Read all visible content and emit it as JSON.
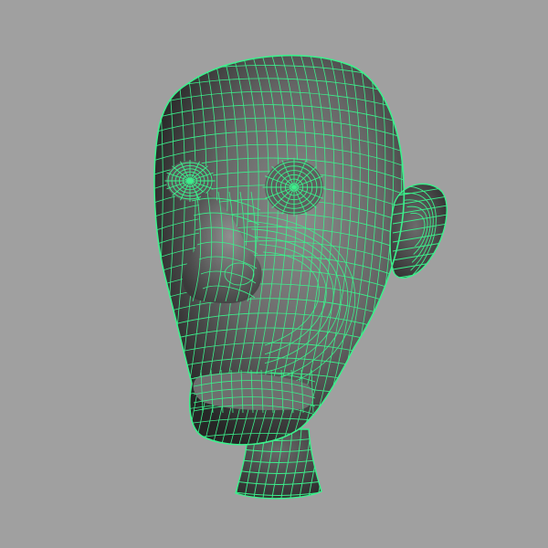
{
  "viewport": {
    "background_color": "#a0a0a0",
    "wireframe_color": "#3cf08c",
    "shade_dark": "#2e2e2e",
    "shade_mid": "#6a6a6a",
    "shade_light": "#8a8a8a",
    "view": "perspective",
    "display_mode": "smooth-shade-with-wireframe-on-shaded",
    "selected": true
  },
  "model": {
    "type": "polygon-mesh",
    "subject": "head",
    "parts": [
      "cranium",
      "face",
      "eye-left",
      "eye-right",
      "nose",
      "mouth",
      "chin",
      "ear-right",
      "neck"
    ]
  }
}
